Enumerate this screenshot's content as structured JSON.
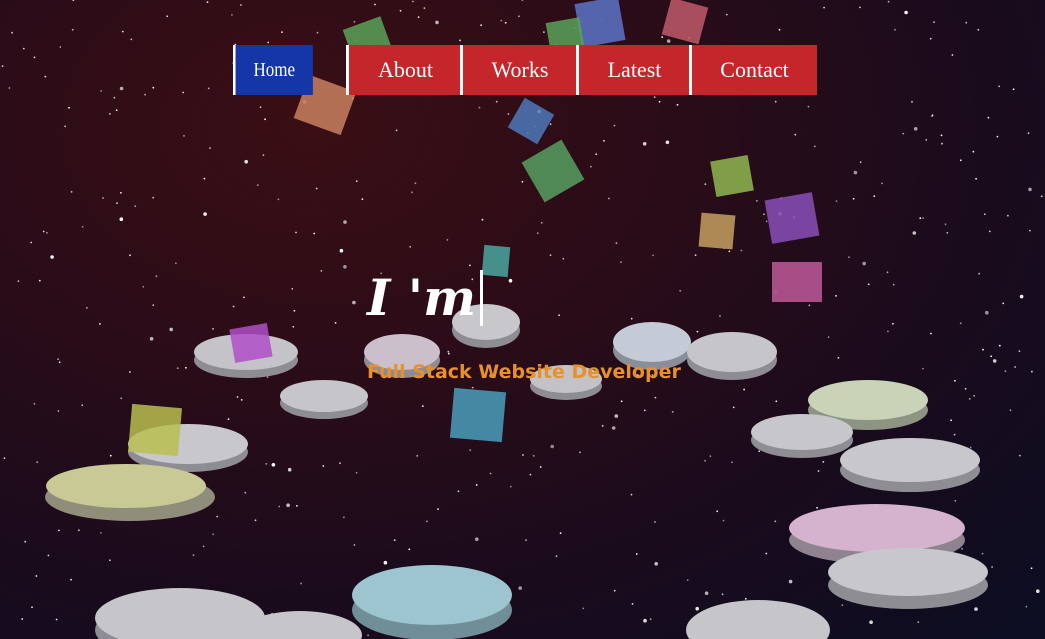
{
  "nav": {
    "items": [
      {
        "label": "Home"
      },
      {
        "label": "About"
      },
      {
        "label": "Works"
      },
      {
        "label": "Latest"
      },
      {
        "label": "Contact"
      }
    ]
  },
  "hero": {
    "title": "I 'm",
    "subtitle": "Full Stack Website Developer"
  }
}
